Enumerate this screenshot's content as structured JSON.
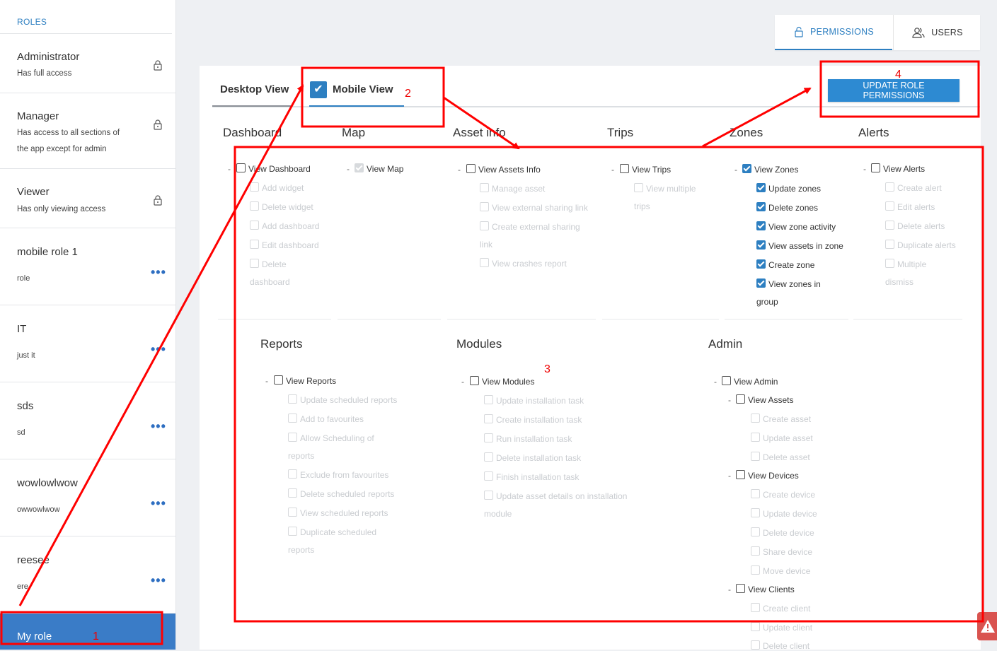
{
  "sidebar": {
    "header": "ROLES",
    "roles": [
      {
        "name": "Administrator",
        "desc": "Has full access"
      },
      {
        "name": "Manager",
        "desc": "Has access to all sections of the app except for admin"
      },
      {
        "name": "Viewer",
        "desc": "Has only viewing access"
      },
      {
        "name": "mobile role 1",
        "desc": "role"
      },
      {
        "name": "IT",
        "desc": "just it"
      },
      {
        "name": "sds",
        "desc": "sd"
      },
      {
        "name": "wowlowlwow",
        "desc": "owwowlwow"
      },
      {
        "name": "reesee",
        "desc": "ere"
      },
      {
        "name": "My role",
        "desc": ""
      }
    ],
    "more_icon": "ellipsis-icon"
  },
  "top_tabs": {
    "permissions": "PERMISSIONS",
    "users": "USERS"
  },
  "view_tabs": {
    "desktop": "Desktop View",
    "mobile": "Mobile View",
    "mobile_checked": true
  },
  "update_button": "UPDATE ROLE PERMISSIONS",
  "sections": {
    "dashboard": {
      "title": "Dashboard",
      "view": "View Dashboard",
      "items": [
        "Add widget",
        "Delete widget",
        "Add dashboard",
        "Edit dashboard",
        "Delete"
      ],
      "wrap": "dashboard"
    },
    "map": {
      "title": "Map",
      "view": "View Map"
    },
    "asset_info": {
      "title": "Asset info",
      "view": "View Assets Info",
      "items": [
        "Manage asset",
        "View external sharing link",
        "Create external sharing",
        "View crashes report"
      ],
      "wrap": "link"
    },
    "trips": {
      "title": "Trips",
      "view": "View Trips",
      "items": [
        "View multiple"
      ],
      "wrap": "trips"
    },
    "zones": {
      "title": "Zones",
      "view": "View Zones",
      "items": [
        "Update zones",
        "Delete zones",
        "View zone activity",
        "View assets in zone",
        "Create zone",
        "View zones in"
      ],
      "wrap": "group"
    },
    "alerts": {
      "title": "Alerts",
      "view": "View Alerts",
      "items": [
        "Create alert",
        "Edit alerts",
        "Delete alerts",
        "Duplicate alerts",
        "Multiple"
      ],
      "wrap": "dismiss"
    },
    "reports": {
      "title": "Reports",
      "view": "View Reports",
      "items": [
        "Update scheduled reports",
        "Add to favourites",
        "Allow Scheduling of",
        "Exclude from favourites",
        "Delete scheduled reports",
        "View scheduled reports",
        "Duplicate scheduled"
      ],
      "wrap1": "reports",
      "wrap2": "reports"
    },
    "modules": {
      "title": "Modules",
      "view": "View Modules",
      "items": [
        "Update installation task",
        "Create installation task",
        "Run installation task",
        "Delete installation task",
        "Finish installation task",
        "Update asset details on installation"
      ],
      "wrap": "module"
    },
    "admin": {
      "title": "Admin",
      "view": "View Admin",
      "assets": {
        "label": "View Assets",
        "items": [
          "Create asset",
          "Update asset",
          "Delete asset"
        ]
      },
      "devices": {
        "label": "View Devices",
        "items": [
          "Create device",
          "Update device",
          "Delete device",
          "Share device",
          "Move device"
        ]
      },
      "clients": {
        "label": "View Clients",
        "items": [
          "Create client",
          "Update client",
          "Delete client"
        ]
      }
    }
  },
  "annotations": {
    "n1": "1",
    "n2": "2",
    "n3": "3",
    "n4": "4",
    "color": "#ff0000"
  }
}
